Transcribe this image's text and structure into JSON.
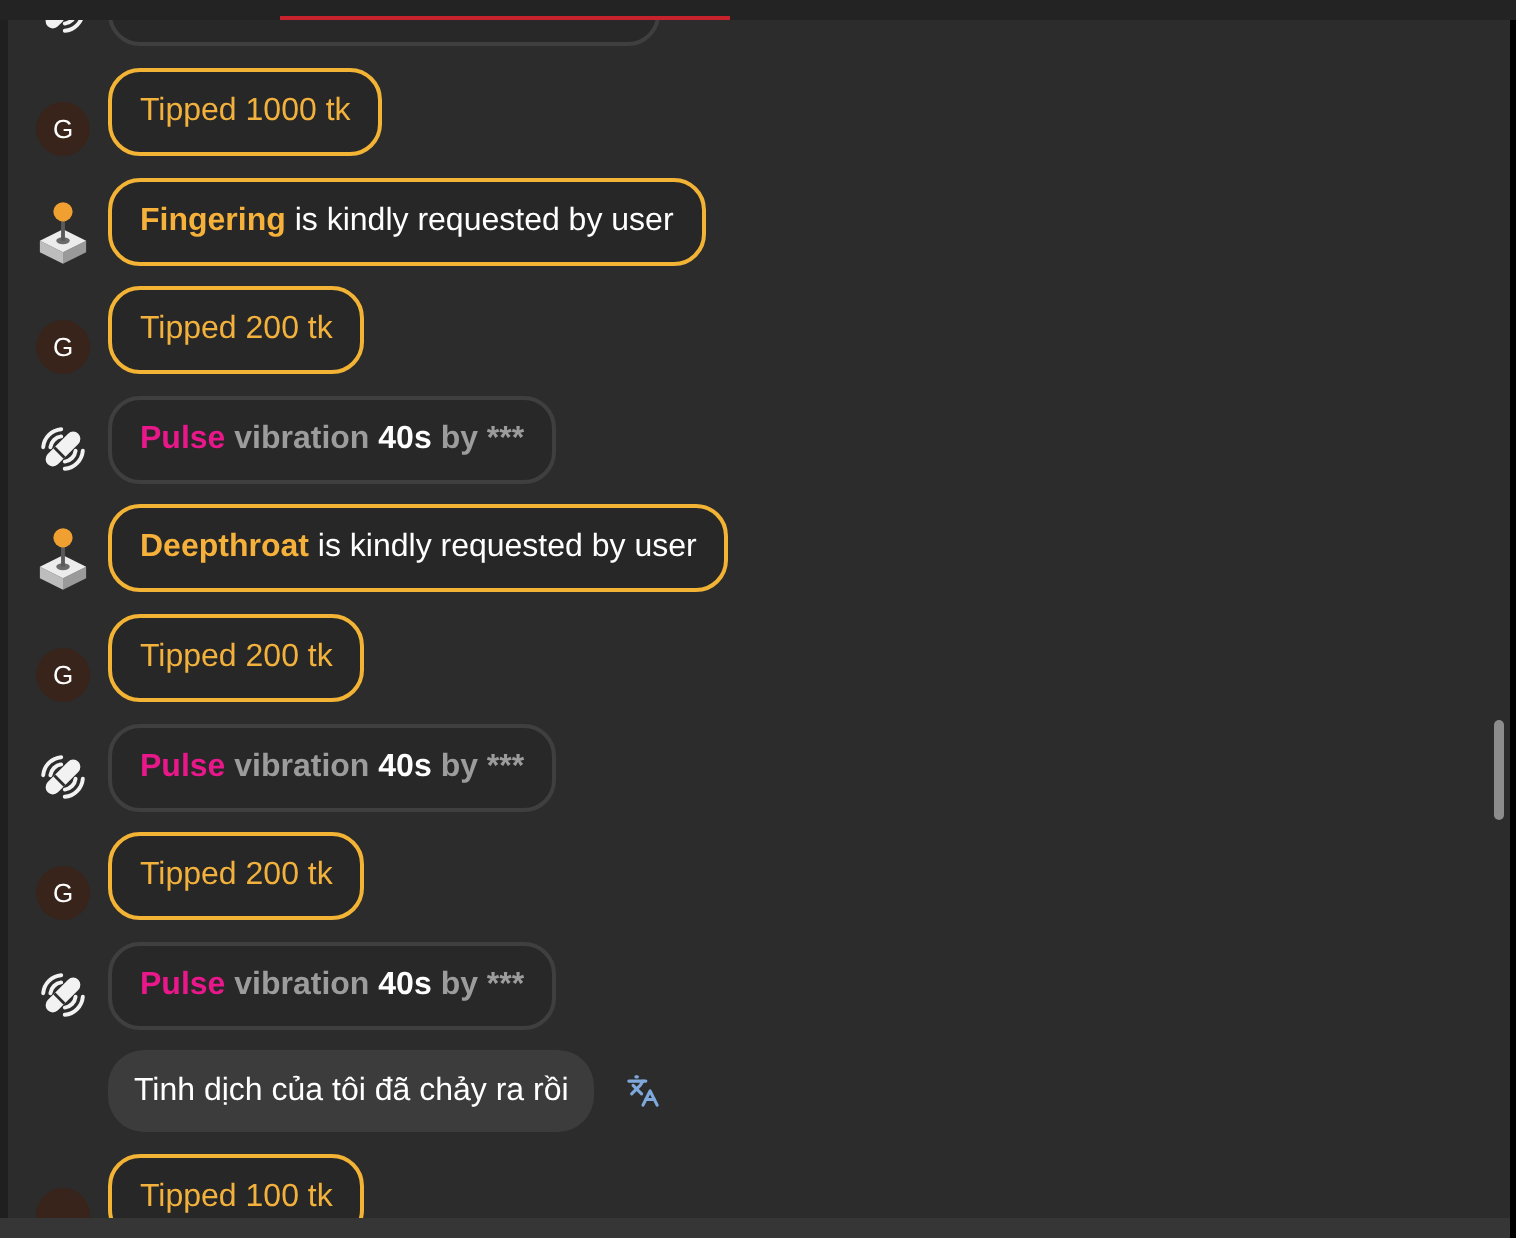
{
  "messages": [
    {
      "kind": "vibration"
    },
    {
      "kind": "tip",
      "avatar": "G",
      "text": "Tipped 1000 tk"
    },
    {
      "kind": "request",
      "action": "Fingering",
      "text": "is kindly requested by user"
    },
    {
      "kind": "tip",
      "avatar": "G",
      "text": "Tipped 200 tk"
    },
    {
      "kind": "vibration",
      "pattern": "Pulse",
      "label": "vibration",
      "duration": "40s",
      "by": "by ***"
    },
    {
      "kind": "request",
      "action": "Deepthroat",
      "text": "is kindly requested by user"
    },
    {
      "kind": "tip",
      "avatar": "G",
      "text": "Tipped 200 tk"
    },
    {
      "kind": "vibration",
      "pattern": "Pulse",
      "label": "vibration",
      "duration": "40s",
      "by": "by ***"
    },
    {
      "kind": "tip",
      "avatar": "G",
      "text": "Tipped 200 tk"
    },
    {
      "kind": "vibration",
      "pattern": "Pulse",
      "label": "vibration",
      "duration": "40s",
      "by": "by ***"
    },
    {
      "kind": "text",
      "text": "Tinh dịch của tôi đã chảy ra rồi"
    },
    {
      "kind": "tip",
      "text": "Tipped 100 tk"
    }
  ]
}
